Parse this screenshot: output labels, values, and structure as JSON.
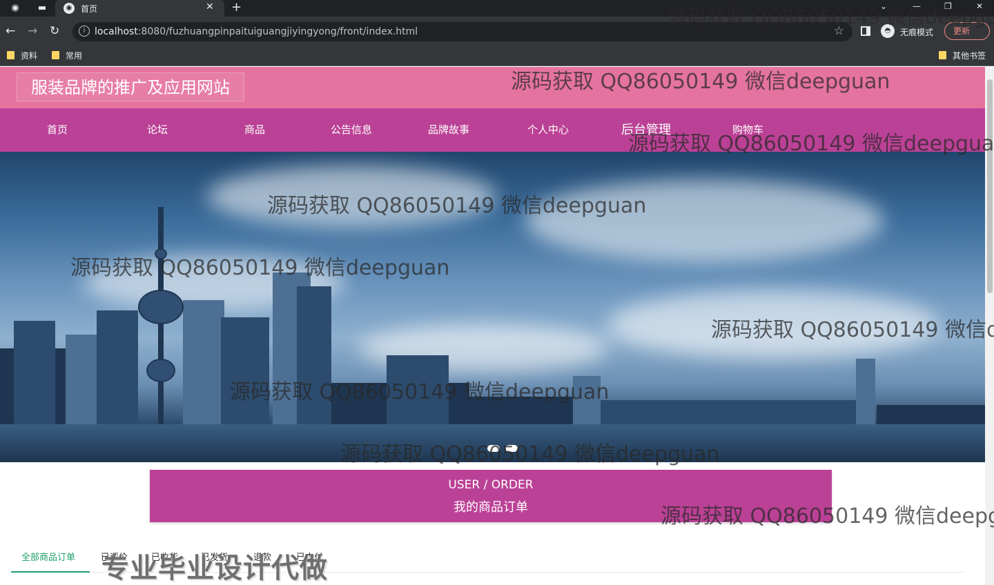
{
  "browser": {
    "tab_title": "首页",
    "url_host": "localhost",
    "url_rest": ":8080/fuzhuangpinpaituiguangjiyingyong/front/index.html",
    "incognito_label": "无痕模式",
    "update_label": "更新",
    "bookmarks": [
      "资料",
      "常用"
    ],
    "other_bookmarks": "其他书签"
  },
  "site": {
    "title": "服装品牌的推广及应用网站",
    "nav": [
      "首页",
      "论坛",
      "商品",
      "公告信息",
      "品牌故事",
      "个人中心",
      "后台管理",
      "购物车"
    ]
  },
  "order_section": {
    "title_en": "USER / ORDER",
    "title_cn": "我的商品订单"
  },
  "order_tabs": [
    "全部商品订单",
    "已评价",
    "已收货",
    "已发货",
    "退款",
    "已支付"
  ],
  "overlay": {
    "watermark": "源码获取 QQ86050149 微信deepguan",
    "big_watermark": "专业毕业设计代做"
  },
  "colors": {
    "header": "#e5739f",
    "nav": "#bb4196",
    "active_tab": "#1f9e6b"
  }
}
